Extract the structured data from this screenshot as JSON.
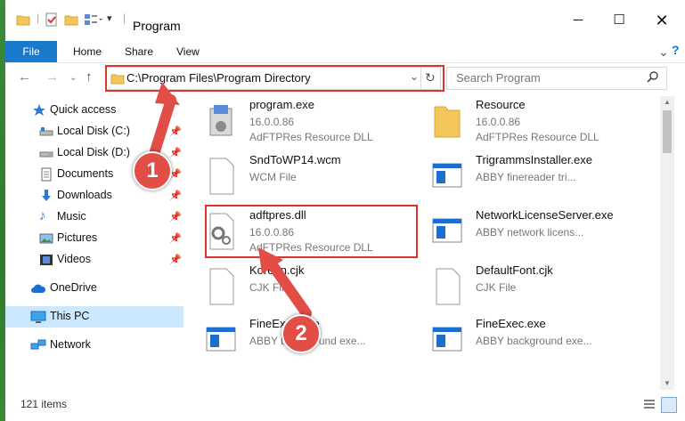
{
  "window": {
    "title": "Program"
  },
  "ribbon": {
    "tabs": [
      "File",
      "Home",
      "Share",
      "View"
    ]
  },
  "address": {
    "path": "C:\\Program Files\\Program Directory",
    "search_placeholder": "Search Program"
  },
  "nav": {
    "items": [
      {
        "label": "Quick access",
        "icon": "star-icon",
        "pinned": false
      },
      {
        "label": "Local Disk (C:)",
        "icon": "drive-icon",
        "pinned": true
      },
      {
        "label": "Local Disk (D:)",
        "icon": "drive-icon",
        "pinned": true
      },
      {
        "label": "Documents",
        "icon": "document-icon",
        "pinned": true
      },
      {
        "label": "Downloads",
        "icon": "download-icon",
        "pinned": true
      },
      {
        "label": "Music",
        "icon": "music-icon",
        "pinned": true
      },
      {
        "label": "Pictures",
        "icon": "pictures-icon",
        "pinned": true
      },
      {
        "label": "Videos",
        "icon": "videos-icon",
        "pinned": true
      },
      {
        "label": "OneDrive",
        "icon": "cloud-icon",
        "pinned": false
      },
      {
        "label": "This PC",
        "icon": "computer-icon",
        "pinned": false
      },
      {
        "label": "Network",
        "icon": "network-icon",
        "pinned": false
      }
    ]
  },
  "files": [
    {
      "name": "program.exe",
      "sub": "16.0.0.86",
      "sub2": "AdFTPRes Resource DLL",
      "icon": "setup-icon"
    },
    {
      "name": "Resource",
      "sub": "16.0.0.86",
      "sub2": "AdFTPRes Resource DLL",
      "icon": "folder-icon"
    },
    {
      "name": "SndToWP14.wcm",
      "sub": "WCM File",
      "sub2": "",
      "icon": "file-icon"
    },
    {
      "name": "TrigrammsInstaller.exe",
      "sub": "ABBY finereader tri...",
      "sub2": "",
      "icon": "app-window-icon"
    },
    {
      "name": "adftpres.dll",
      "sub": "16.0.0.86",
      "sub2": "AdFTPRes Resource DLL",
      "icon": "dll-gear-icon"
    },
    {
      "name": "NetworkLicenseServer.exe",
      "sub": "ABBY network licens...",
      "sub2": "",
      "icon": "app-window-icon"
    },
    {
      "name": "Korean.cjk",
      "sub": "CJK File",
      "sub2": "",
      "icon": "file-icon"
    },
    {
      "name": "DefaultFont.cjk",
      "sub": "CJK File",
      "sub2": "",
      "icon": "file-icon"
    },
    {
      "name": "FineExec.exe",
      "sub": "ABBY background exe...",
      "sub2": "",
      "icon": "app-window-icon"
    },
    {
      "name": "FineExec.exe",
      "sub": "ABBY background exe...",
      "sub2": "",
      "icon": "app-window-icon"
    }
  ],
  "status": {
    "item_count": "121 items"
  },
  "annotations": {
    "step1": "1",
    "step2": "2"
  }
}
